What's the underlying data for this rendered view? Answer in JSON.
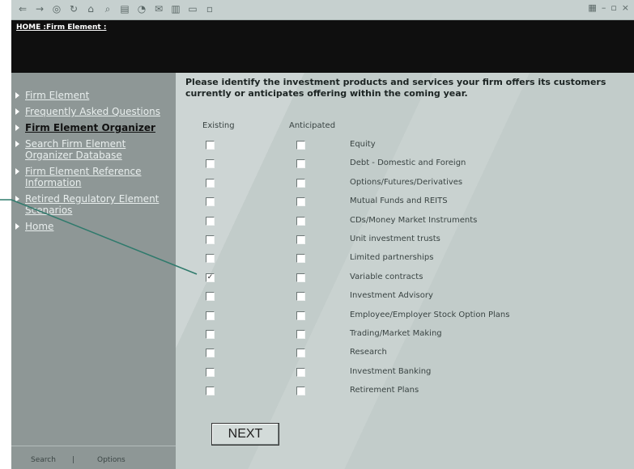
{
  "breadcrumb": "HOME :Firm Element :",
  "sidebar": {
    "items": [
      {
        "label": "Firm Element"
      },
      {
        "label": "Frequently Asked Questions"
      },
      {
        "label": "Firm Element Organizer"
      },
      {
        "label": "Search Firm Element Organizer Database"
      },
      {
        "label": "Firm Element Reference Information"
      },
      {
        "label": "Retired Regulatory Element Scenarios"
      },
      {
        "label": "Home"
      }
    ],
    "bottom_links": [
      "Search",
      "|",
      "Options"
    ]
  },
  "main": {
    "prompt": "Please identify the investment products and services your firm offers its customers currently or anticipates offering within the coming year.",
    "columns": {
      "existing": "Existing",
      "anticipated": "Anticipated"
    },
    "rows": [
      {
        "label": "Equity",
        "existing": false,
        "anticipated": false
      },
      {
        "label": "Debt - Domestic and Foreign",
        "existing": false,
        "anticipated": false
      },
      {
        "label": "Options/Futures/Derivatives",
        "existing": false,
        "anticipated": false
      },
      {
        "label": "Mutual Funds and REITS",
        "existing": false,
        "anticipated": false
      },
      {
        "label": "CDs/Money Market Instruments",
        "existing": false,
        "anticipated": false
      },
      {
        "label": "Unit investment trusts",
        "existing": false,
        "anticipated": false
      },
      {
        "label": "Limited partnerships",
        "existing": false,
        "anticipated": false
      },
      {
        "label": "Variable contracts",
        "existing": true,
        "anticipated": false
      },
      {
        "label": "Investment Advisory",
        "existing": false,
        "anticipated": false
      },
      {
        "label": "Employee/Employer Stock Option Plans",
        "existing": false,
        "anticipated": false
      },
      {
        "label": "Trading/Market Making",
        "existing": false,
        "anticipated": false
      },
      {
        "label": "Research",
        "existing": false,
        "anticipated": false
      },
      {
        "label": "Investment Banking",
        "existing": false,
        "anticipated": false
      },
      {
        "label": "Retirement Plans",
        "existing": false,
        "anticipated": false
      }
    ],
    "next_label": "NEXT"
  },
  "toolbar": {
    "icons": [
      "back-icon",
      "forward-icon",
      "stop-icon",
      "refresh-icon",
      "home-icon",
      "search-icon",
      "favorites-icon",
      "history-icon",
      "mail-icon",
      "print-icon",
      "edit-icon",
      "discuss-icon"
    ]
  }
}
